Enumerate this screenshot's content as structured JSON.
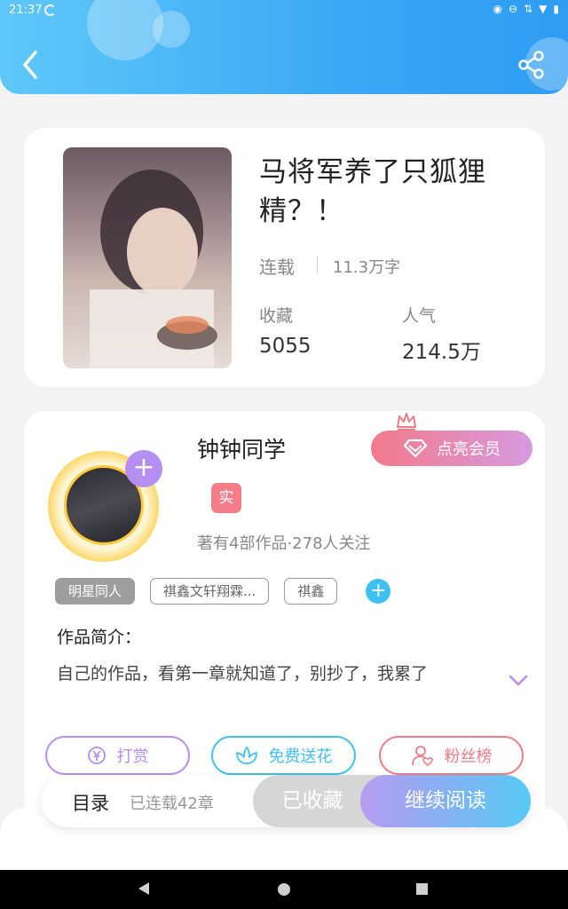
{
  "status_bar": {
    "time": "21:37"
  },
  "header": {
    "back_icon": "chevron-left-icon",
    "share_icon": "share-icon"
  },
  "book": {
    "title": "马将军养了只狐狸精？！",
    "status": "连载",
    "word_count": "11.3万字",
    "stats": [
      {
        "label": "收藏",
        "value": "5055"
      },
      {
        "label": "人气",
        "value": "214.5万"
      }
    ]
  },
  "author": {
    "name": "钟钟同学",
    "verified_badge": "实",
    "meta": "著有4部作品·278人关注",
    "vip_button": "点亮会员",
    "tags": [
      "明星同人",
      "祺鑫文轩翔霖...",
      "祺鑫"
    ],
    "intro_title": "作品简介：",
    "intro_text": "自己的作品，看第一章就知道了，别抄了，我累了"
  },
  "actions": [
    {
      "label": "打赏",
      "icon": "yen-coin-icon",
      "color": "#b48ef0"
    },
    {
      "label": "免费送花",
      "icon": "flower-icon",
      "color": "#3cc1f0"
    },
    {
      "label": "粉丝榜",
      "icon": "fan-user-icon",
      "color": "#f27a86"
    }
  ],
  "bottom_bar": {
    "toc_label": "目录",
    "toc_count": "已连载42章",
    "collected_label": "已收藏",
    "continue_label": "继续阅读"
  }
}
